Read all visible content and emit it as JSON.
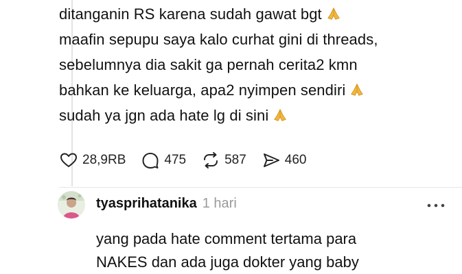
{
  "post": {
    "lines": [
      "ditanganin RS karena sudah gawat bgt",
      "maafin sepupu saya kalo curhat gini di threads,",
      "sebelumnya dia sakit ga pernah cerita2 kmn",
      "bahkan ke keluarga, apa2 nyimpen sendiri",
      "sudah ya jgn ada hate lg di sini"
    ],
    "emoji": "folded-hands"
  },
  "actions": {
    "likes": "28,9RB",
    "comments": "475",
    "reposts": "587",
    "shares": "460"
  },
  "reply": {
    "username": "tyasprihatanika",
    "time": "1 hari",
    "lines": [
      "yang pada hate comment tertama para",
      "NAKES dan ada juga dokter yang baby"
    ]
  },
  "colors": {
    "text": "#111111",
    "muted": "#9a9a9a",
    "divider": "#e6e6e6",
    "emoji": "#f2b63c"
  }
}
